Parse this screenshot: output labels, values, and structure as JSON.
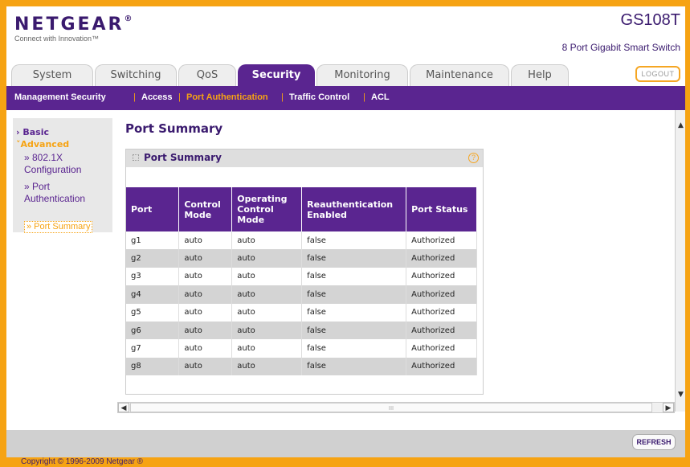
{
  "header": {
    "logo": "NETGEAR",
    "logo_mark": "®",
    "tagline": "Connect with Innovation™",
    "model": "GS108T",
    "model_desc": "8 Port Gigabit Smart Switch",
    "logout": "LOGOUT"
  },
  "tabs": [
    "System",
    "Switching",
    "QoS",
    "Security",
    "Monitoring",
    "Maintenance",
    "Help"
  ],
  "active_tab": "Security",
  "subnav": [
    "Management Security",
    "Access",
    "Port Authentication",
    "Traffic Control",
    "ACL"
  ],
  "subnav_sep": "|",
  "sidebar": {
    "basic": "Basic",
    "advanced": "Advanced",
    "item1": "» 802.1X Configuration",
    "item2": "» Port Authentication",
    "item3": "» Port Summary"
  },
  "page_title": "Port Summary",
  "panel": {
    "title": "Port Summary",
    "help": "?"
  },
  "table": {
    "headers": [
      "Port",
      "Control Mode",
      "Operating Control Mode",
      "Reauthentication Enabled",
      "Port Status"
    ],
    "rows": [
      [
        "g1",
        "auto",
        "auto",
        "false",
        "Authorized"
      ],
      [
        "g2",
        "auto",
        "auto",
        "false",
        "Authorized"
      ],
      [
        "g3",
        "auto",
        "auto",
        "false",
        "Authorized"
      ],
      [
        "g4",
        "auto",
        "auto",
        "false",
        "Authorized"
      ],
      [
        "g5",
        "auto",
        "auto",
        "false",
        "Authorized"
      ],
      [
        "g6",
        "auto",
        "auto",
        "false",
        "Authorized"
      ],
      [
        "g7",
        "auto",
        "auto",
        "false",
        "Authorized"
      ],
      [
        "g8",
        "auto",
        "auto",
        "false",
        "Authorized"
      ]
    ]
  },
  "scroll_thumb": "III",
  "refresh": "REFRESH",
  "footer": "Copyright © 1996-2009 Netgear ®",
  "colors": {
    "brand_purple": "#5a2590",
    "brand_orange": "#f6a313"
  }
}
